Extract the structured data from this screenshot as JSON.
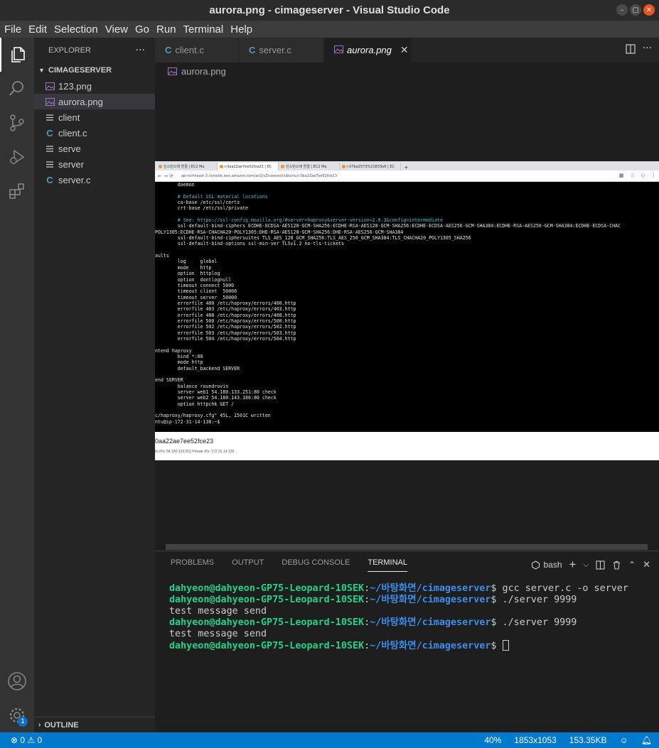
{
  "window": {
    "title": "aurora.png - cimageserver - Visual Studio Code",
    "controls": [
      "–",
      "▢",
      "✕"
    ]
  },
  "menu": [
    "File",
    "Edit",
    "Selection",
    "View",
    "Go",
    "Run",
    "Terminal",
    "Help"
  ],
  "activity": [
    {
      "icon": "files-icon"
    },
    {
      "icon": "search-icon"
    },
    {
      "icon": "source-control-icon"
    },
    {
      "icon": "run-debug-icon"
    },
    {
      "icon": "extensions-icon"
    },
    {
      "icon": "account-icon"
    },
    {
      "icon": "gear-icon",
      "badge": "1"
    }
  ],
  "sidebar": {
    "title": "EXPLORER",
    "more": "···",
    "folder": "CIMAGESERVER",
    "files": [
      {
        "name": "123.png",
        "type": "image"
      },
      {
        "name": "aurora.png",
        "type": "image",
        "selected": true
      },
      {
        "name": "client",
        "type": "binary"
      },
      {
        "name": "client.c",
        "type": "c"
      },
      {
        "name": "serve",
        "type": "binary"
      },
      {
        "name": "server",
        "type": "binary"
      },
      {
        "name": "server.c",
        "type": "c"
      }
    ],
    "outline": "OUTLINE"
  },
  "tabs": [
    {
      "label": "client.c",
      "icon": "C",
      "close": ""
    },
    {
      "label": "server.c",
      "icon": "C",
      "close": ""
    },
    {
      "label": "aurora.png",
      "icon": "image",
      "close": "✕"
    }
  ],
  "breadcrumb": "aurora.png",
  "image": {
    "browser_tabs": [
      "인스턴스에 연결 | EC2 Ma",
      "i-0aa22ae7ee52fce23 | EC",
      "인스턴스에 연결 | EC2 Ma",
      "i-07ba2573%21833e6 | EC"
    ],
    "address": "ap-northeast-2.console.aws.amazon.com/ec2/v2/connect/ubuntu/i-0aa22ae7ee52fce23",
    "terminal_lines": [
      "        daemon",
      "",
      "        # Default SSL material locations",
      "        ca-base /etc/ssl/certs",
      "        crt-base /etc/ssl/private",
      "",
      "        # See: https://ssl-config.mozilla.org/#server=haproxy&server-version=2.0.3&config=intermediate",
      "        ssl-default-bind-ciphers ECDHE-ECDSA-AES128-GCM-SHA256:ECDHE-RSA-AES128-GCM-SHA256:ECDHE-ECDSA-AES256-GCM-SHA384:ECDHE-RSA-AES256-GCM-SHA384:ECDHE-ECDSA-CHAC",
      "POLY1305:ECDHE-RSA-CHACHA20-POLY1305:DHE-RSA-AES128-GCM-SHA256:DHE-RSA-AES256-GCM-SHA384",
      "        ssl-default-bind-ciphersuites TLS_AES_128_GCM_SHA256:TLS_AES_256_GCM_SHA384:TLS_CHACHA20_POLY1305_SHA256",
      "        ssl-default-bind-options ssl-min-ver TLSv1.2 no-tls-tickets",
      "",
      "aults",
      "        log     global",
      "        mode    http",
      "        option  httplog",
      "        option  dontlognull",
      "        timeout connect 5000",
      "        timeout client  50000",
      "        timeout server  50000",
      "        errorfile 400 /etc/haproxy/errors/400.http",
      "        errorfile 403 /etc/haproxy/errors/403.http",
      "        errorfile 408 /etc/haproxy/errors/408.http",
      "        errorfile 500 /etc/haproxy/errors/500.http",
      "        errorfile 502 /etc/haproxy/errors/502.http",
      "        errorfile 503 /etc/haproxy/errors/503.http",
      "        errorfile 504 /etc/haproxy/errors/504.http",
      "",
      "ntend haproxy",
      "        bind *:80",
      "        mode http",
      "        default_backend SERVER",
      "",
      "end SERVER",
      "        balance roundrovin",
      "        server web1 54.180.133.251:80 check",
      "        server web2 54.180.143.186:80 check",
      "        option httpchk GET /",
      "",
      "c/haproxy/haproxy.cfg\" 45L, 1501C written",
      "ntu@ip-172-31-14-138:~$ "
    ],
    "instance_id": "0aa22ae7ee52fce23",
    "ips": "lic IPs: 54.180.133.251      Private IPs: 172.31.14.138"
  },
  "panel": {
    "tabs": [
      "PROBLEMS",
      "OUTPUT",
      "DEBUG CONSOLE",
      "TERMINAL"
    ],
    "active_tab": "TERMINAL",
    "shell": "bash",
    "terminal": {
      "user": "dahyeon@dahyeon-GP75-Leopard-10SEK",
      "path": "~/바탕화면/cimageserver",
      "cmd1": " gcc server.c -o server",
      "cmd2": " ./server 9999",
      "out1": "test message send",
      "cmd3": " ./server 9999",
      "out2": "test message send"
    }
  },
  "status": {
    "problems": "⊗ 0 ⚠ 0",
    "zoom": "40%",
    "dimensions": "1853x1053",
    "size": "153.35KB"
  },
  "colors": {
    "accent": "#007acc",
    "user_green": "#23d18b",
    "path_blue": "#3b8eea"
  }
}
